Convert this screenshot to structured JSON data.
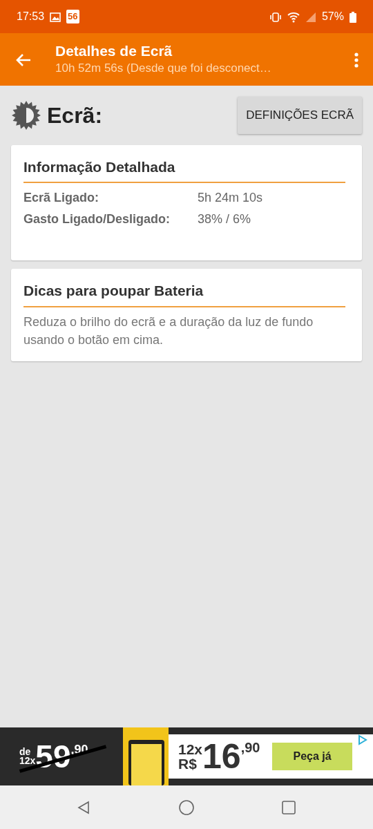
{
  "status_bar": {
    "time": "17:53",
    "carrier_badge": "56",
    "battery": "57%"
  },
  "app_bar": {
    "title": "Detalhes de Ecrã",
    "subtitle": "10h 52m 56s (Desde que foi desconect…"
  },
  "header": {
    "title": "Ecrã:",
    "button": "DEFINIÇÕES ECRÃ"
  },
  "cards": [
    {
      "kind": "details",
      "title": "Informação Detalhada",
      "rows": [
        {
          "label": "Ecrã Ligado:",
          "value": "5h 24m 10s"
        },
        {
          "label": "Gasto Ligado/Desligado:",
          "value": "38% / 6%"
        }
      ]
    },
    {
      "kind": "text",
      "title": "Dicas para poupar Bateria",
      "text": "Reduza o brilho do ecrã e a duração da luz de fundo usando o botão em cima."
    }
  ],
  "ad": {
    "old_prefix": [
      "de",
      "12x"
    ],
    "old_price": "59",
    "old_cents": ",90",
    "new_prefix": [
      "12x",
      "R$"
    ],
    "new_price": "16",
    "new_cents": ",90",
    "cta": "Peça já"
  }
}
